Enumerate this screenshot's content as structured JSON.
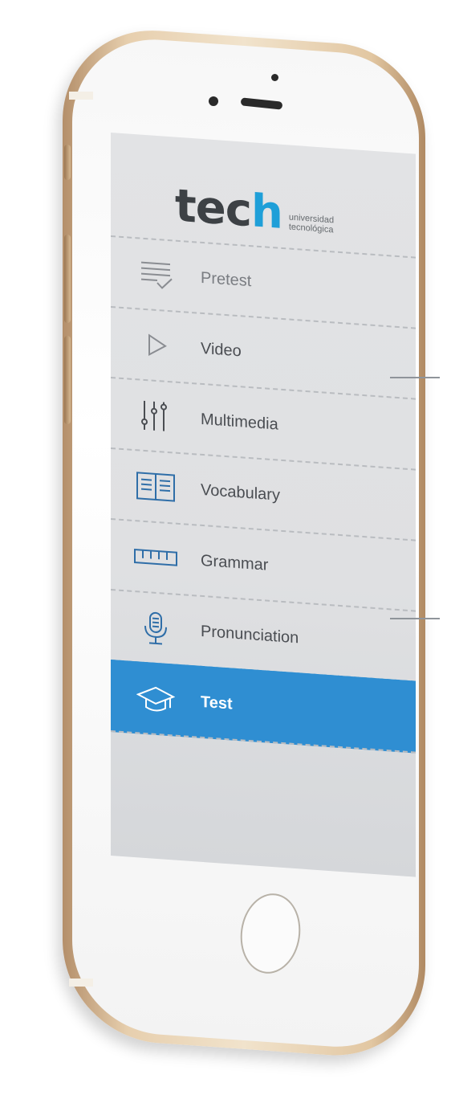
{
  "logo": {
    "word_main": "tec",
    "word_accent": "h",
    "sub_line1": "universidad",
    "sub_line2": "tecnológica"
  },
  "menu": {
    "items": [
      {
        "label": "Pretest",
        "icon": "checklist-icon"
      },
      {
        "label": "Video",
        "icon": "play-icon"
      },
      {
        "label": "Multimedia",
        "icon": "sliders-icon"
      },
      {
        "label": "Vocabulary",
        "icon": "book-icon"
      },
      {
        "label": "Grammar",
        "icon": "ruler-icon"
      },
      {
        "label": "Pronunciation",
        "icon": "microphone-icon"
      },
      {
        "label": "Test",
        "icon": "graduation-cap-icon",
        "active": true
      }
    ]
  },
  "colors": {
    "accent_blue": "#2f8ed2",
    "logo_blue": "#1f9fd8",
    "screen_bg": "#e2e3e5",
    "phone_gold": "#e7cfae"
  }
}
